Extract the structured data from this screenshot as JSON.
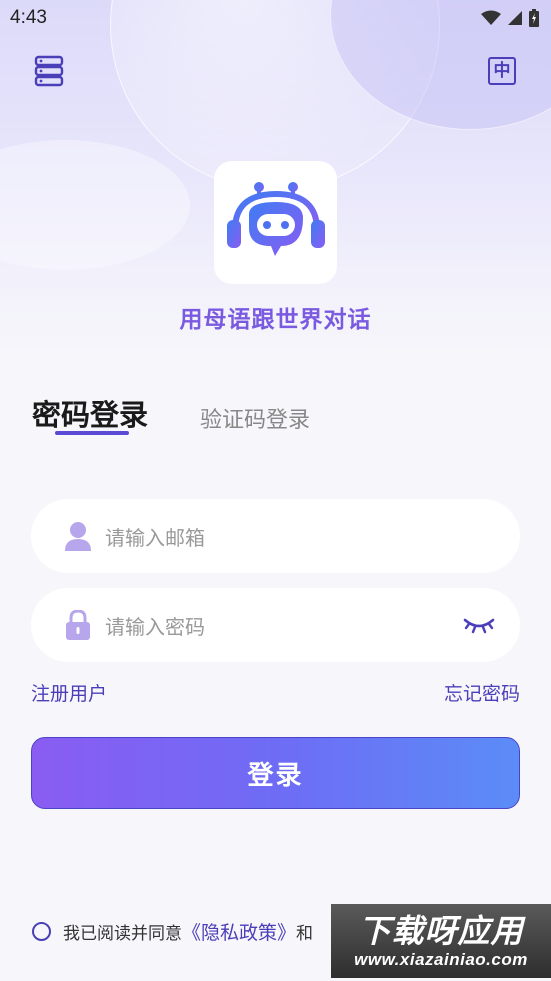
{
  "status_bar": {
    "time": "4:43",
    "icons": [
      "wifi-icon",
      "signal-icon",
      "battery-icon"
    ]
  },
  "header": {
    "left_icon": "server-list-icon",
    "right_icon_label": "中"
  },
  "branding": {
    "logo_icon": "robot-headphones-icon",
    "slogan": "用母语跟世界对话"
  },
  "tabs": [
    {
      "label": "密码登录",
      "active": true
    },
    {
      "label": "验证码登录",
      "active": false
    }
  ],
  "form": {
    "email_placeholder": "请输入邮箱",
    "password_placeholder": "请输入密码"
  },
  "links": {
    "register": "注册用户",
    "forgot": "忘记密码"
  },
  "login_button": "登录",
  "agreement": {
    "prefix": "我已阅读并同意",
    "policy": "《隐私政策》",
    "and": "和"
  },
  "watermark": {
    "main": "下载呀应用",
    "sub": "www.xiazainiao.com"
  },
  "colors": {
    "accent": "#5a4ad6",
    "link": "#4a3fb8",
    "slogan": "#7a5ae0",
    "button_start": "#8a5cf2",
    "button_end": "#5b8cf7"
  }
}
